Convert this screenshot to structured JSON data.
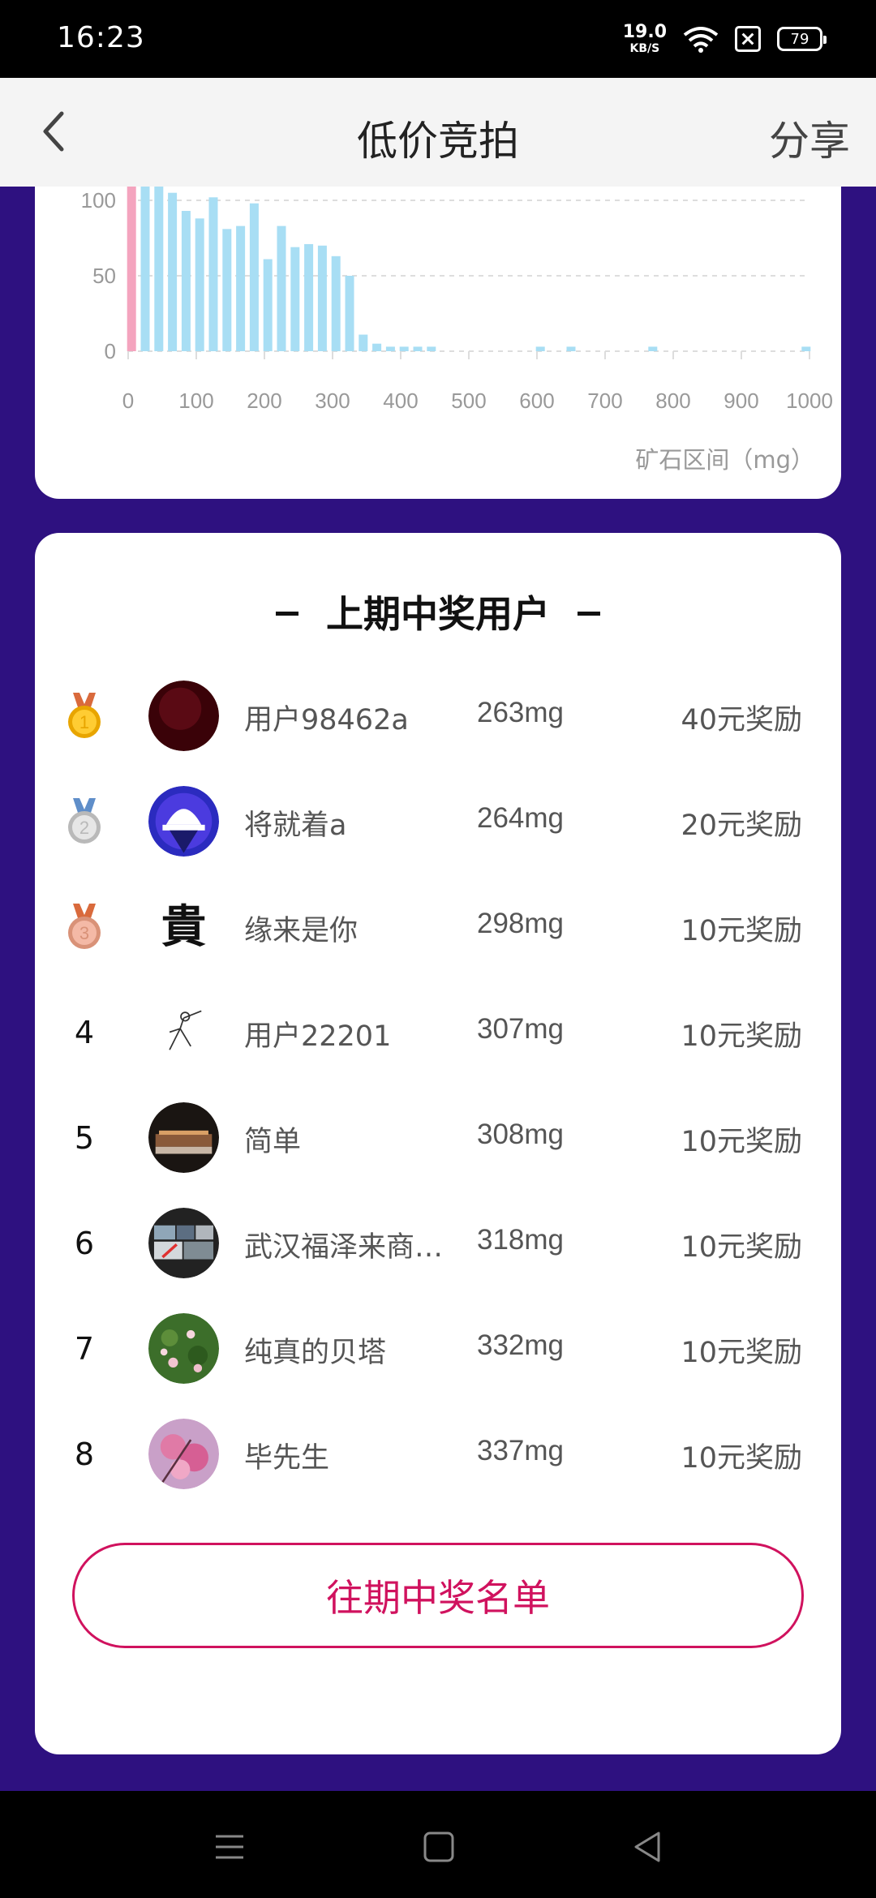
{
  "status_bar": {
    "time": "16:23",
    "net_speed_value": "19.0",
    "net_speed_unit": "KB/S",
    "battery": "79",
    "icons": [
      "wifi-icon",
      "sim-icon",
      "battery-icon"
    ]
  },
  "header": {
    "title": "低价竞拍",
    "share_label": "分享",
    "back_icon": "chevron-left-icon"
  },
  "chart_data": {
    "type": "bar",
    "x_ticks": [
      "0",
      "100",
      "200",
      "300",
      "400",
      "500",
      "600",
      "700",
      "800",
      "900",
      "1000"
    ],
    "y_ticks": [
      "0",
      "50",
      "100"
    ],
    "xlim": [
      0,
      1000
    ],
    "ylim": [
      0,
      100
    ],
    "xlabel": "矿石区间（mg）",
    "grid": "horizontal dashed",
    "colors": {
      "bars": "#a8def4",
      "highlight": "#f4a4be"
    },
    "bars": [
      {
        "x": 5,
        "y": 150,
        "highlight": true
      },
      {
        "x": 25,
        "y": 150
      },
      {
        "x": 45,
        "y": 150
      },
      {
        "x": 65,
        "y": 105
      },
      {
        "x": 85,
        "y": 93
      },
      {
        "x": 105,
        "y": 88
      },
      {
        "x": 125,
        "y": 102
      },
      {
        "x": 145,
        "y": 81
      },
      {
        "x": 165,
        "y": 83
      },
      {
        "x": 185,
        "y": 98
      },
      {
        "x": 205,
        "y": 61
      },
      {
        "x": 225,
        "y": 83
      },
      {
        "x": 245,
        "y": 69
      },
      {
        "x": 265,
        "y": 71
      },
      {
        "x": 285,
        "y": 70
      },
      {
        "x": 305,
        "y": 63
      },
      {
        "x": 325,
        "y": 50
      },
      {
        "x": 345,
        "y": 11
      },
      {
        "x": 365,
        "y": 5
      },
      {
        "x": 385,
        "y": 3
      },
      {
        "x": 405,
        "y": 3
      },
      {
        "x": 425,
        "y": 3
      },
      {
        "x": 445,
        "y": 3
      },
      {
        "x": 605,
        "y": 3
      },
      {
        "x": 650,
        "y": 3
      },
      {
        "x": 770,
        "y": 3
      },
      {
        "x": 995,
        "y": 3
      }
    ]
  },
  "winners": {
    "title": "上期中奖用户",
    "rows": [
      {
        "rank": "1",
        "medal": "gold",
        "name": "用户98462a",
        "weight": "263mg",
        "reward": "40元奖励",
        "avatar": "dark-red"
      },
      {
        "rank": "2",
        "medal": "silver",
        "name": "将就着a",
        "weight": "264mg",
        "reward": "20元奖励",
        "avatar": "blue-helmet"
      },
      {
        "rank": "3",
        "medal": "bronze",
        "name": "缘来是你",
        "weight": "298mg",
        "reward": "10元奖励",
        "avatar": "calligraphy"
      },
      {
        "rank": "4",
        "name": "用户22201",
        "weight": "307mg",
        "reward": "10元奖励",
        "avatar": "sketch"
      },
      {
        "rank": "5",
        "name": "简单",
        "weight": "308mg",
        "reward": "10元奖励",
        "avatar": "night-building"
      },
      {
        "rank": "6",
        "name": "武汉福泽来商…",
        "weight": "318mg",
        "reward": "10元奖励",
        "avatar": "collage"
      },
      {
        "rank": "7",
        "name": "纯真的贝塔",
        "weight": "332mg",
        "reward": "10元奖励",
        "avatar": "flowers-green"
      },
      {
        "rank": "8",
        "name": "毕先生",
        "weight": "337mg",
        "reward": "10元奖励",
        "avatar": "pink-blossom"
      }
    ],
    "history_button": "往期中奖名单"
  },
  "nav_bar": {
    "icons": [
      "menu-icon",
      "home-square-icon",
      "back-triangle-icon"
    ]
  }
}
